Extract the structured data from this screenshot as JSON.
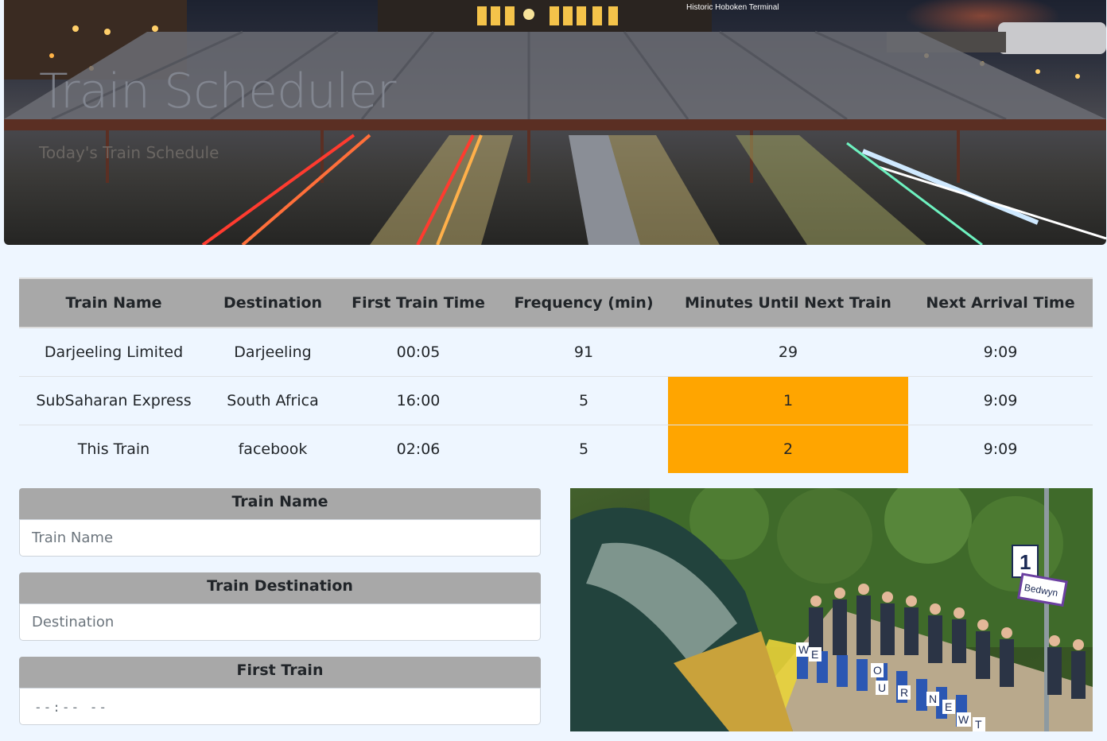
{
  "hero": {
    "caption": "Historic Hoboken Terminal",
    "title": "Train Scheduler",
    "subtitle": "Today's Train Schedule"
  },
  "table": {
    "headers": [
      "Train Name",
      "Destination",
      "First Train Time",
      "Frequency (min)",
      "Minutes Until Next Train",
      "Next Arrival Time"
    ],
    "rows": [
      {
        "name": "Darjeeling Limited",
        "destination": "Darjeeling",
        "first": "00:05",
        "frequency": "91",
        "minutes": "29",
        "next": "9:09",
        "highlight": false
      },
      {
        "name": "SubSaharan Express",
        "destination": "South Africa",
        "first": "16:00",
        "frequency": "5",
        "minutes": "1",
        "next": "9:09",
        "highlight": true
      },
      {
        "name": "This Train",
        "destination": "facebook",
        "first": "02:06",
        "frequency": "5",
        "minutes": "2",
        "next": "9:09",
        "highlight": true
      }
    ],
    "highlight_color": "#ffa500",
    "header_bg": "#a8a8a8"
  },
  "form": {
    "train_name": {
      "label": "Train Name",
      "placeholder": "Train Name",
      "value": ""
    },
    "destination": {
      "label": "Train Destination",
      "placeholder": "Destination",
      "value": ""
    },
    "first_train": {
      "label": "First Train",
      "placeholder": "--:--  --",
      "value": ""
    }
  },
  "photo": {
    "sign_number": "1",
    "sign_station": "Bedwyn",
    "placard_letters": [
      "W",
      "E",
      "O",
      "U",
      "R",
      "N",
      "E",
      "W",
      "T"
    ]
  }
}
